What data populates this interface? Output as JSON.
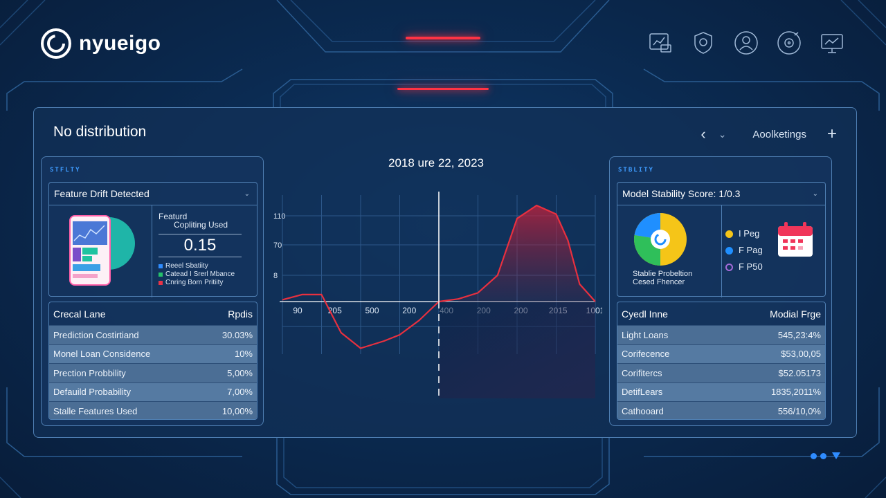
{
  "brand": {
    "name": "nyueigo"
  },
  "top_icons": [
    "document-chart-icon",
    "shield-badge-icon",
    "user-icon",
    "vinyl-icon",
    "monitor-icon"
  ],
  "panel": {
    "title": "No distribution",
    "back_label": "‹",
    "dropdown_label": "⌄",
    "settings_label": "Aoolketings",
    "add_label": "+"
  },
  "left_card": {
    "tag": "STFLTY",
    "dropdown_title": "Feature Drift Detected",
    "metric_label_1": "Featurd",
    "metric_label_2": "Copliting Used",
    "metric_value": "0.15",
    "legend": [
      {
        "label": "Reeel Sbatiity",
        "color": "#2f8cff"
      },
      {
        "label": "Catead I Srerl Mbance",
        "color": "#25c06b"
      },
      {
        "label": "Cnring Born Pritiity",
        "color": "#e83347"
      }
    ],
    "table": {
      "col1": "Crecal Lane",
      "col2": "Rpdis",
      "rows": [
        {
          "name": "Prediction Costirtiand",
          "value": "30.03%"
        },
        {
          "name": "Monel Loan Considence",
          "value": "10%"
        },
        {
          "name": "Prection Probbility",
          "value": "5,00%"
        },
        {
          "name": "Defauild Probability",
          "value": "7,00%"
        },
        {
          "name": "Stalle Features Used",
          "value": "10,00%"
        }
      ]
    }
  },
  "right_card": {
    "tag": "STBLITY",
    "dropdown_title": "Model Stability Score: 1/0.3",
    "donut_caption_1": "Stablie Probeltion",
    "donut_caption_2": "Cesed Fhencer",
    "legend": [
      {
        "label": "I Peg",
        "color": "#f5c518"
      },
      {
        "label": "F Pag",
        "color": "#1f8fff"
      },
      {
        "label": "F P50",
        "color": "#a36bd9"
      }
    ],
    "table": {
      "col1": "Cyedl Inne",
      "col2": "Modial Frge",
      "rows": [
        {
          "name": "Light Loans",
          "value": "545,23:4%"
        },
        {
          "name": "Corifecence",
          "value": "$53,00,05"
        },
        {
          "name": "Corifitercs",
          "value": "$52.05173"
        },
        {
          "name": "DetifLears",
          "value": "1835,2011%"
        },
        {
          "name": "Cathooard",
          "value": "556/10,0%"
        }
      ]
    }
  },
  "chart_data": {
    "type": "line",
    "title": "2018 ure 22, 2023",
    "y_ticks": [
      "110",
      "70",
      "8"
    ],
    "x_ticks": [
      "90",
      "205",
      "500",
      "200",
      "400",
      "200",
      "200",
      "2015",
      "1001"
    ],
    "series": [
      {
        "color": "#e8303f",
        "x": [
          0,
          0.5,
          1,
          1.5,
          2,
          2.6,
          3,
          3.5,
          4,
          4.5,
          5,
          5.5,
          6,
          6.5,
          7,
          7.3,
          7.6,
          8
        ],
        "values": [
          2,
          8,
          8,
          -30,
          -45,
          -38,
          -32,
          -18,
          0,
          3,
          10,
          30,
          95,
          110,
          100,
          70,
          20,
          0
        ]
      }
    ],
    "ylim": [
      -60,
      125
    ],
    "grid": true,
    "marker_x": 4
  },
  "colors": {
    "accent_red": "#ff3344",
    "accent_blue": "#3f9cff",
    "panel_border": "#4f7fb3"
  }
}
